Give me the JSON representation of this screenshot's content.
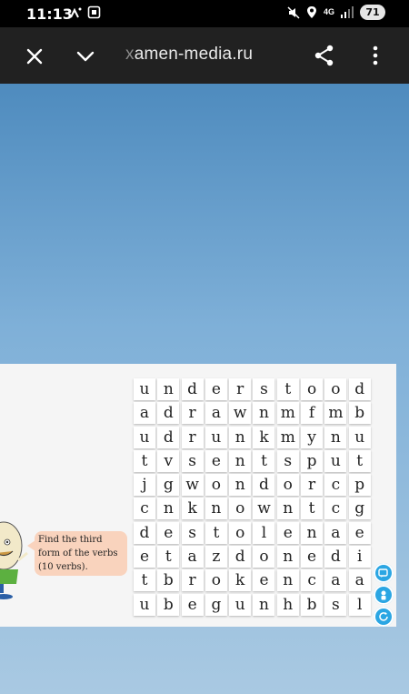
{
  "status_bar": {
    "time": "11:13",
    "network": "4G",
    "battery": "71"
  },
  "toolbar": {
    "url_fade": "x",
    "url": "amen-media.ru"
  },
  "puzzle": {
    "instruction": "Find the third form of the verbs (10 verbs).",
    "rows": [
      [
        "u",
        "n",
        "d",
        "e",
        "r",
        "s",
        "t",
        "o",
        "o",
        "d"
      ],
      [
        "a",
        "d",
        "r",
        "a",
        "w",
        "n",
        "m",
        "f",
        "m",
        "b"
      ],
      [
        "u",
        "d",
        "r",
        "u",
        "n",
        "k",
        "m",
        "y",
        "n",
        "u"
      ],
      [
        "t",
        "v",
        "s",
        "e",
        "n",
        "t",
        "s",
        "p",
        "u",
        "t"
      ],
      [
        "j",
        "g",
        "w",
        "o",
        "n",
        "d",
        "o",
        "r",
        "c",
        "p"
      ],
      [
        "c",
        "n",
        "k",
        "n",
        "o",
        "w",
        "n",
        "t",
        "c",
        "g"
      ],
      [
        "d",
        "e",
        "s",
        "t",
        "o",
        "l",
        "e",
        "n",
        "a",
        "e"
      ],
      [
        "e",
        "t",
        "a",
        "z",
        "d",
        "o",
        "n",
        "e",
        "d",
        "i"
      ],
      [
        "t",
        "b",
        "r",
        "o",
        "k",
        "e",
        "n",
        "c",
        "a",
        "a"
      ],
      [
        "u",
        "b",
        "e",
        "g",
        "u",
        "n",
        "h",
        "b",
        "s",
        "l"
      ]
    ]
  },
  "colors": {
    "toolbar_bg": "#212121",
    "accent": "#2ba6e3",
    "bubble_bg": "#f9d3bd"
  },
  "icons": {
    "close": "close-icon",
    "chevron": "chevron-down-icon",
    "share": "share-icon",
    "more": "more-vert-icon",
    "side_buttons": [
      "edit-icon",
      "person-icon",
      "refresh-icon"
    ]
  }
}
